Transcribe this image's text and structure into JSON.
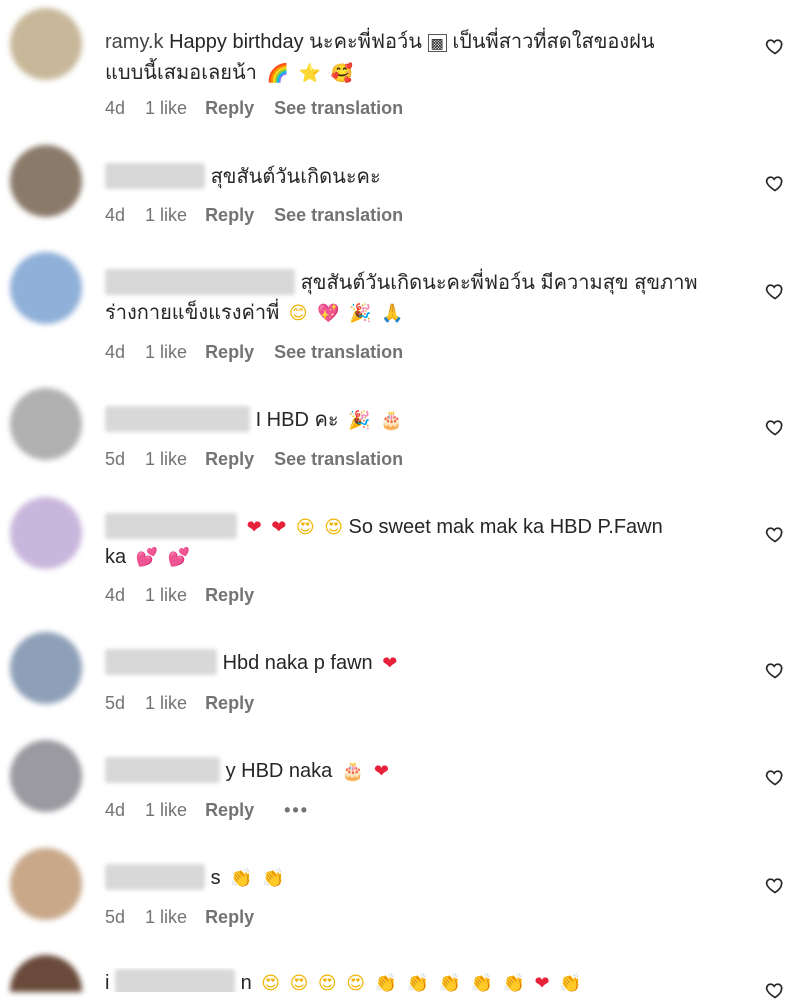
{
  "comments": [
    {
      "name_fragment": "ramy.k",
      "text": "Happy birthday นะคะพี่ฟอว์น",
      "text2": "เป็นพี่สาวที่สดใสของฝน",
      "text3": "แบบนี้เสมอเลยน้า",
      "emojis": [
        "🌈",
        "⭐",
        "🥰"
      ],
      "time": "4d",
      "likes": "1 like",
      "reply": "Reply",
      "translation": "See translation",
      "avatar_color": "#c8b89a"
    },
    {
      "text": "สุขสันต์วันเกิดนะคะ",
      "time": "4d",
      "likes": "1 like",
      "reply": "Reply",
      "translation": "See translation",
      "avatar_color": "#8a7a6a"
    },
    {
      "text": "สุขสันต์วันเกิดนะคะพี่ฟอว์น มีความสุข สุขภาพ",
      "text2": "ร่างกายแข็งแรงค่าพี่",
      "emojis": [
        "😊",
        "💖",
        "🎉",
        "🙏"
      ],
      "time": "4d",
      "likes": "1 like",
      "reply": "Reply",
      "translation": "See translation",
      "avatar_color": "#8fb0d8"
    },
    {
      "text": "I HBD คะ",
      "emojis": [
        "🎉",
        "🎂"
      ],
      "time": "5d",
      "likes": "1 like",
      "reply": "Reply",
      "translation": "See translation",
      "avatar_color": "#b0b0b0"
    },
    {
      "text": "So sweet mak mak ka HBD P.Fawn",
      "text2": "ka",
      "pre_emojis": [
        "❤",
        "❤",
        "😍",
        "😍"
      ],
      "emojis2": [
        "💕",
        "💕"
      ],
      "time": "4d",
      "likes": "1 like",
      "reply": "Reply",
      "avatar_color": "#c9b6dc"
    },
    {
      "text": "Hbd naka p fawn",
      "emojis": [
        "❤"
      ],
      "time": "5d",
      "likes": "1 like",
      "reply": "Reply",
      "avatar_color": "#8ea0b8"
    },
    {
      "text": "y HBD naka",
      "emojis": [
        "🎂",
        "❤"
      ],
      "time": "4d",
      "likes": "1 like",
      "reply": "Reply",
      "more": "•••",
      "avatar_color": "#9a9aa0"
    },
    {
      "text": "s",
      "emojis": [
        "👏",
        "👏"
      ],
      "time": "5d",
      "likes": "1 like",
      "reply": "Reply",
      "avatar_color": "#c9a88a"
    },
    {
      "text": "i",
      "text_tail": "n",
      "emojis": [
        "😍",
        "😍",
        "😍",
        "😍",
        "👏",
        "👏",
        "👏",
        "👏",
        "👏",
        "❤",
        "👏"
      ],
      "avatar_color": "#6a4a3a"
    }
  ]
}
